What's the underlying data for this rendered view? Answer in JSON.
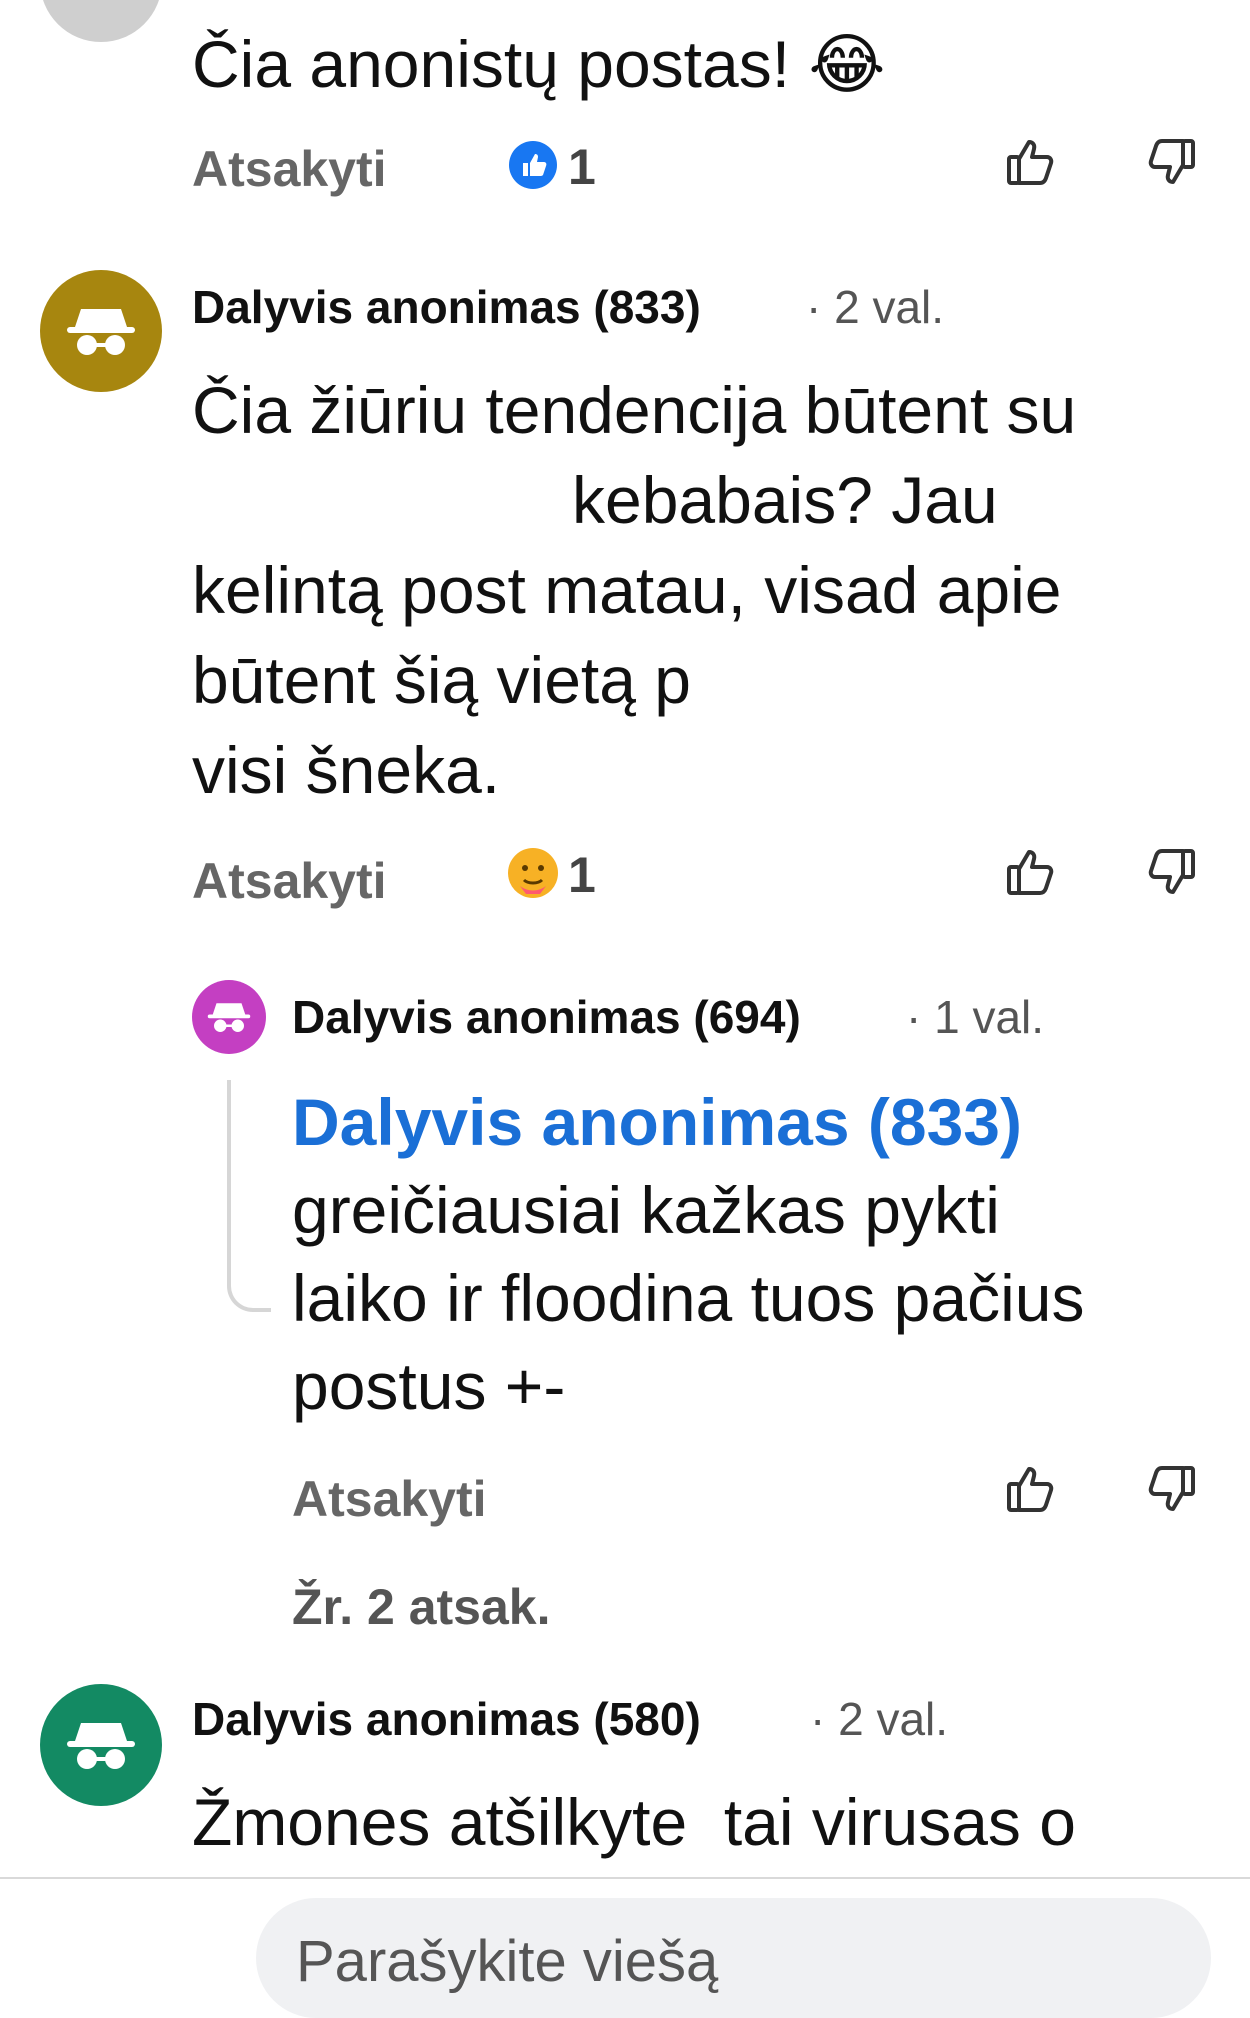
{
  "colors": {
    "accent_blue": "#1a6fd6",
    "avatar_833": "#a7860f",
    "avatar_694": "#c43fc2",
    "avatar_580": "#138a63"
  },
  "comment_top": {
    "text": "Čia anonistų postas! 😂",
    "reply_label": "Atsakyti",
    "reaction_icon": "like-reaction-icon",
    "reaction_count": "1"
  },
  "comment_833": {
    "author": "Dalyvis anonimas (833)",
    "time": "· 2 val.",
    "lines": [
      "Čia žiūriu tendencija būtent su",
      "kebabais? Jau",
      "kelintą post matau, visad apie",
      "būtent šią vietą p",
      "visi šneka."
    ],
    "reply_label": "Atsakyti",
    "reaction_icon": "hug-reaction-icon",
    "reaction_count": "1"
  },
  "reply_694": {
    "author": "Dalyvis anonimas (694)",
    "time": "· 1 val.",
    "mention": "Dalyvis anonimas (833)",
    "lines": [
      "greičiausiai kažkas pykti",
      "laiko ir floodina tuos pačius",
      "postus +-"
    ],
    "reply_label": "Atsakyti",
    "see_replies": "Žr. 2 atsak."
  },
  "comment_580": {
    "author": "Dalyvis anonimas (580)",
    "time": "· 2 val.",
    "text": "Žmones atšilkyte  tai virusas o"
  },
  "composer": {
    "placeholder": "Parašykite viešą"
  }
}
